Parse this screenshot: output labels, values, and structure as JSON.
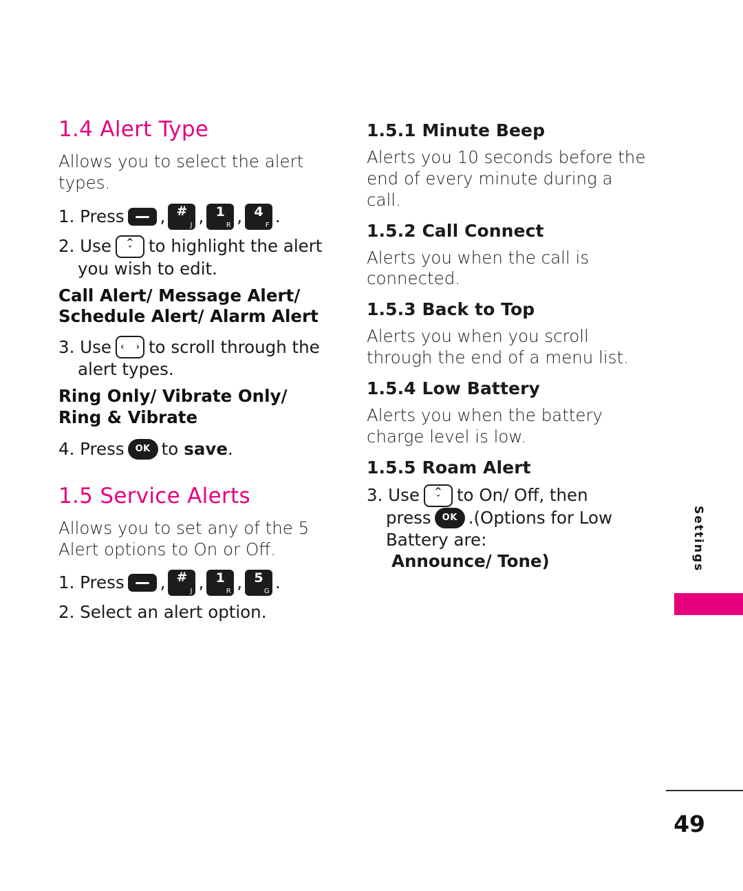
{
  "page": {
    "number": "49",
    "side_tab": "Settings"
  },
  "left_column": {
    "section_1": {
      "heading": "1.4 Alert Type",
      "intro": "Allows you to select the alert types.",
      "step1_pre": "1. Press",
      "step1_comma1": ",",
      "step1_comma2": ",",
      "step1_comma3": ",",
      "step1_end": ".",
      "step2_pre": "2. Use",
      "step2_post": "to highlight the alert",
      "step2_cont": "you wish to edit.",
      "bold_options_1": "Call Alert/ Message Alert/",
      "bold_options_2": "Schedule Alert/ Alarm Alert",
      "step3_pre": "3. Use",
      "step3_post": "to scroll through the",
      "step3_cont": "alert types.",
      "bold_options_3": "Ring Only/ Vibrate Only/",
      "bold_options_4": "Ring & Vibrate",
      "step4_pre": "4. Press",
      "step4_mid": "to",
      "step4_bold": "save",
      "step4_end": "."
    },
    "section_2": {
      "heading": "1.5 Service Alerts",
      "intro": "Allows you to set any of the 5 Alert options to On or Off.",
      "step1_pre": "1. Press",
      "step1_comma1": ",",
      "step1_comma2": ",",
      "step1_comma3": ",",
      "step1_end": ".",
      "step2": "2. Select an alert option."
    }
  },
  "right_column": {
    "items": [
      {
        "heading": "1.5.1 Minute Beep",
        "body": "Alerts you 10 seconds before the end of every minute during a call."
      },
      {
        "heading": "1.5.2 Call Connect",
        "body": "Alerts you when the call is connected."
      },
      {
        "heading": "1.5.3 Back to Top",
        "body": "Alerts you when you scroll through the end of a menu list."
      },
      {
        "heading": "1.5.4 Low Battery",
        "body": "Alerts you when the battery charge level is low."
      },
      {
        "heading": "1.5.5 Roam Alert",
        "step_pre": "3. Use",
        "step_post": "to On/ Off, then",
        "step_line2_pre": "press",
        "step_line2_post": ".(Options for Low",
        "step_line3_pre": "Battery are:",
        "step_line3_bold": "Announce/ Tone)"
      }
    ]
  },
  "keys": {
    "menu": {
      "name": "menu-key",
      "label": ""
    },
    "hash": {
      "big": "#",
      "small": "J"
    },
    "one": {
      "big": "1",
      "small": "R"
    },
    "four": {
      "big": "4",
      "small": "F"
    },
    "five": {
      "big": "5",
      "small": "G"
    },
    "ok": {
      "label": "OK"
    },
    "nav_vertical": {
      "up": "^",
      "down": "ˇ"
    },
    "nav_horizontal": {
      "left": "‹",
      "right": "›"
    }
  },
  "colors": {
    "accent": "#e6007e",
    "text": "#1a1a1a",
    "key_dark": "#1c1c1c"
  }
}
